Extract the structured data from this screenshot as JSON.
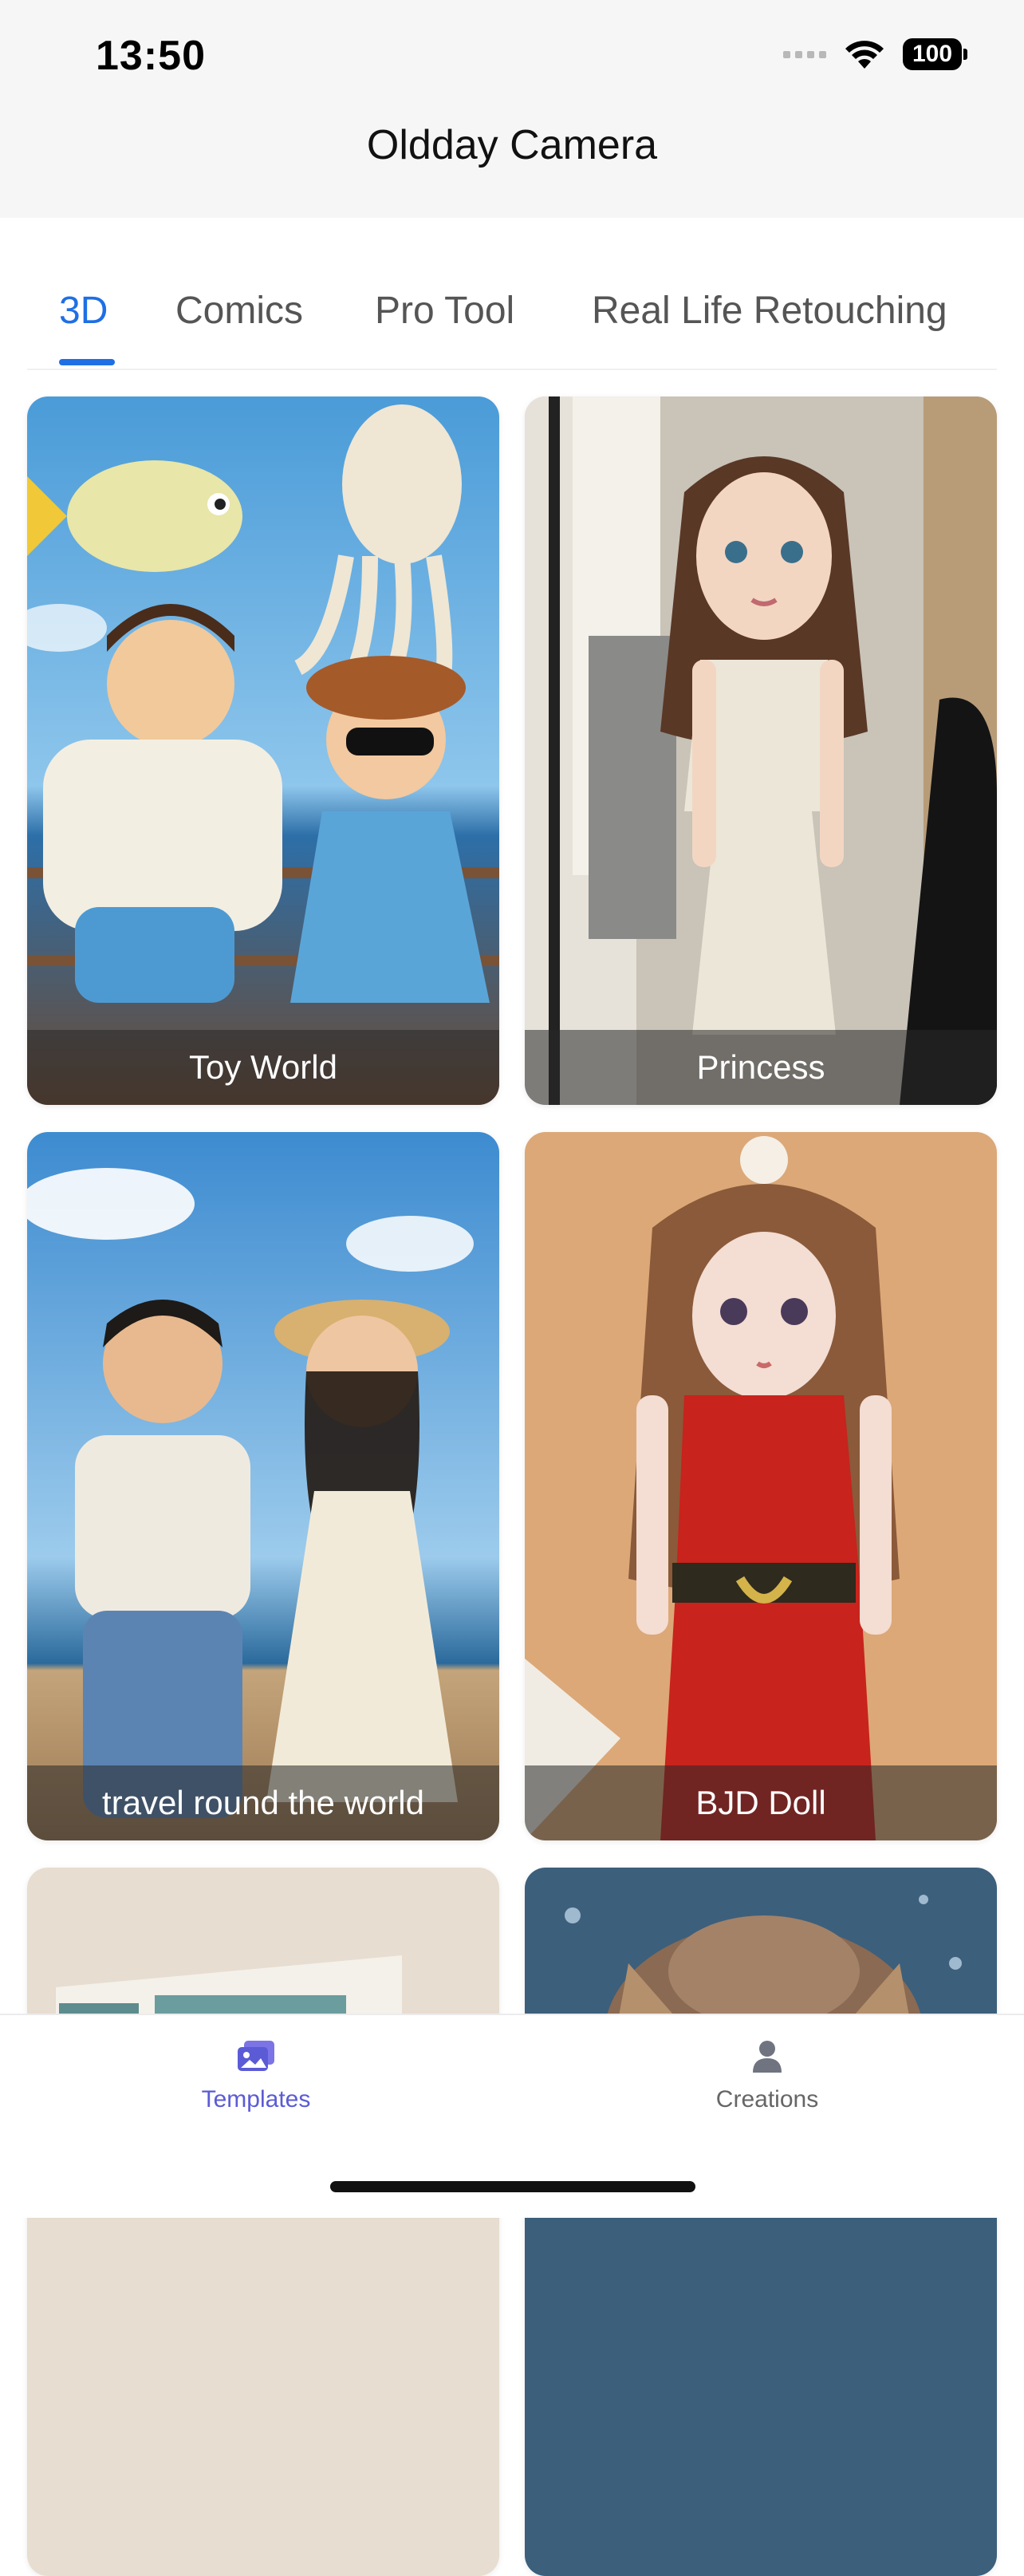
{
  "status_bar": {
    "time": "13:50",
    "battery": "100"
  },
  "nav": {
    "title": "Oldday Camera"
  },
  "tabs": [
    {
      "label": "3D",
      "active": true
    },
    {
      "label": "Comics",
      "active": false
    },
    {
      "label": "Pro Tool",
      "active": false
    },
    {
      "label": "Real Life Retouching",
      "active": false
    }
  ],
  "templates": [
    {
      "caption": "Toy World"
    },
    {
      "caption": "Princess"
    },
    {
      "caption": "travel round the world"
    },
    {
      "caption": "BJD Doll"
    }
  ],
  "bottom_nav": {
    "templates_label": "Templates",
    "creations_label": "Creations"
  },
  "colors": {
    "accent": "#1f6fe5",
    "bottom_active": "#5b5bd6"
  }
}
